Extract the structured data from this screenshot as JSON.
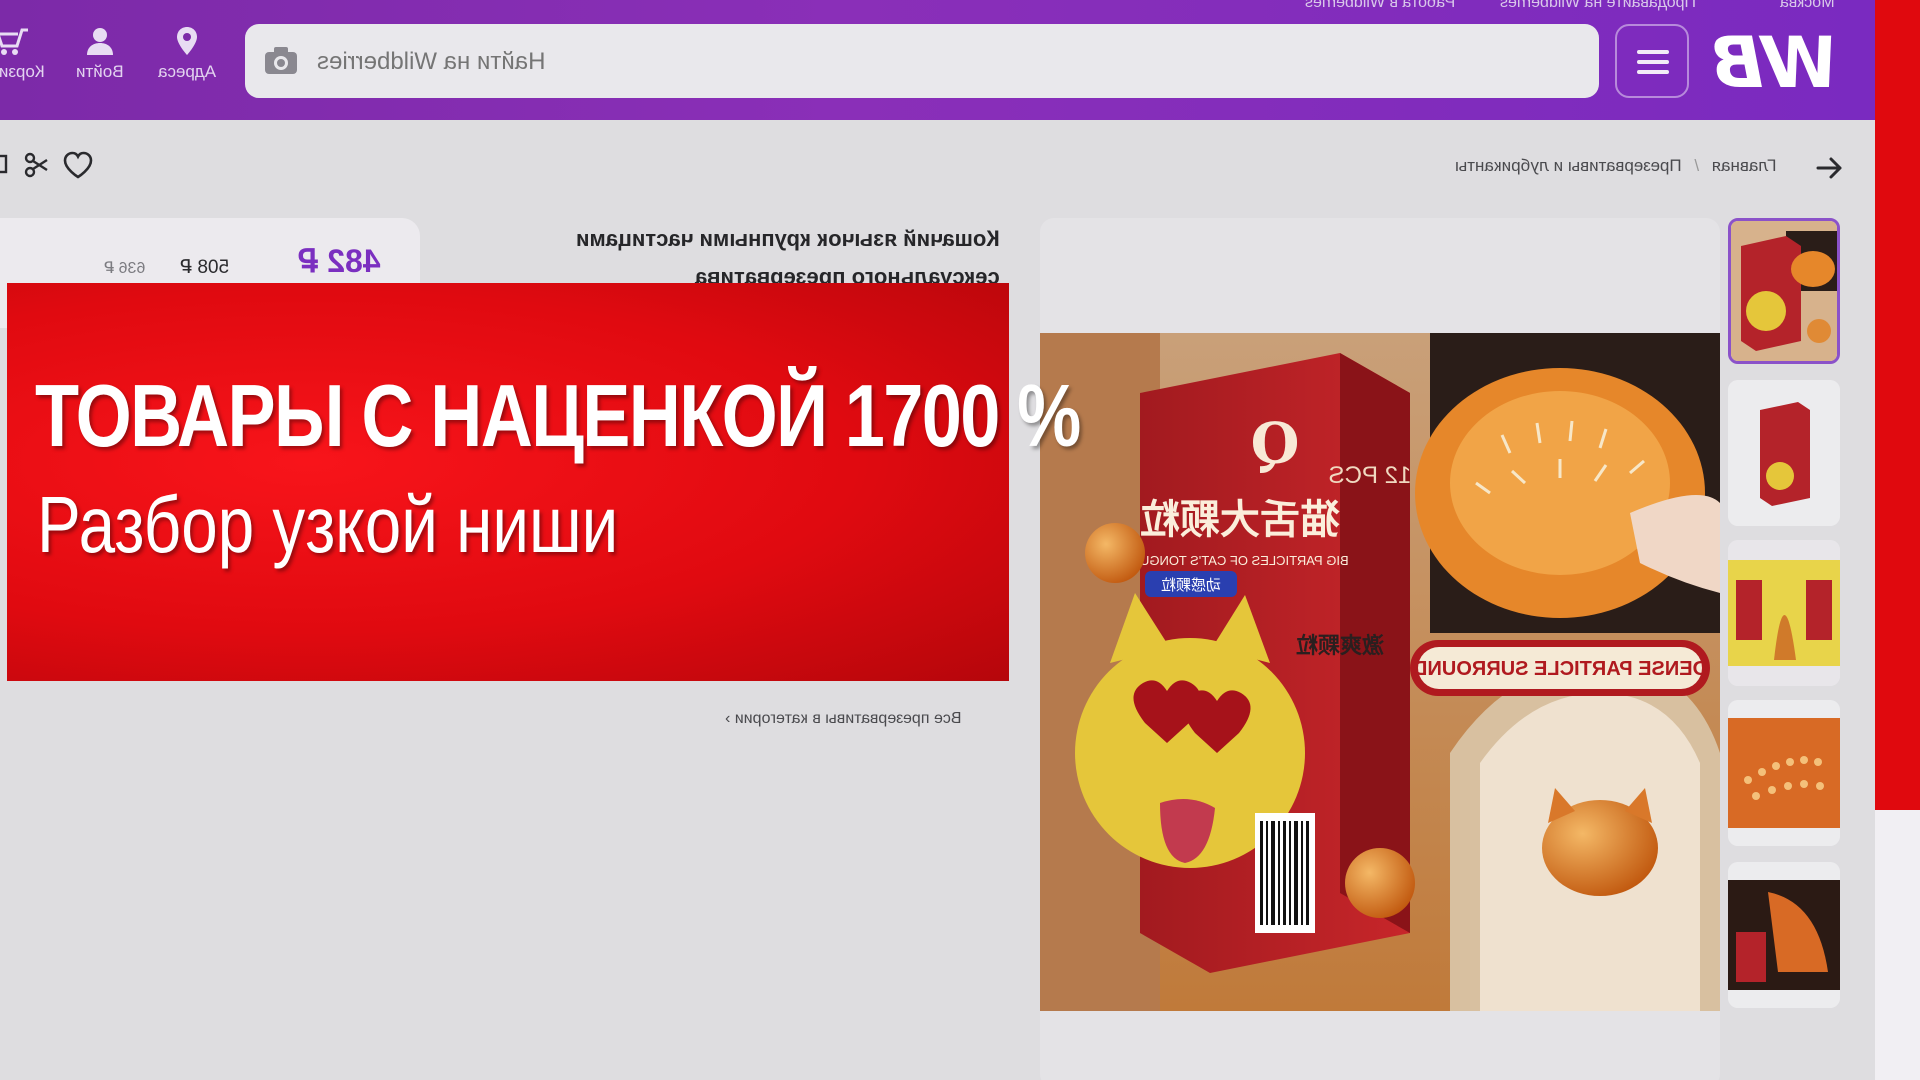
{
  "header": {
    "logo": "WB",
    "search_placeholder": "Найти на Wildberries",
    "top_links": [
      "Москва",
      "Продавайте на Wildberries",
      "Работа в Wildberries"
    ],
    "icons": [
      {
        "name": "address",
        "label": "Адреса"
      },
      {
        "name": "login",
        "label": "Войти"
      },
      {
        "name": "cart",
        "label": "Корзина"
      }
    ]
  },
  "breadcrumbs": {
    "items": [
      "Главная",
      "Презервативы и лубриканты"
    ],
    "separator": "/"
  },
  "product": {
    "title_line1": "Кошачий язычок крупными частицами",
    "title_line2": "сексуального презерватива",
    "price": "482 ₽",
    "price_wallet": "508 ₽",
    "price_old": "636 ₽",
    "category_link": "Все презервативы в категории ›"
  },
  "product_image": {
    "brand_mark": "Q",
    "box_chinese": "猫舌大颗粒",
    "box_english": "BIG PARTICLES OF CAT'S TONGUE",
    "count": "12 PCS",
    "label_blue": "动感颗粒",
    "side_text": "激爽颗粒",
    "ribbon": "DENSE PARTICLE SURROUND"
  },
  "thumbnails": [
    {
      "alt": "thumbnail-1",
      "active": true
    },
    {
      "alt": "thumbnail-2",
      "active": false
    },
    {
      "alt": "thumbnail-3",
      "active": false
    },
    {
      "alt": "thumbnail-4",
      "active": false
    },
    {
      "alt": "thumbnail-5",
      "active": false
    }
  ],
  "banner": {
    "title": "ТОВАРЫ С НАЦЕНКОЙ 1700 %",
    "subtitle": "Разбор узкой ниши"
  },
  "colors": {
    "header_purple": "#7c2aa8",
    "banner_red": "#e00a10",
    "price_purple": "#7b2fc0"
  }
}
